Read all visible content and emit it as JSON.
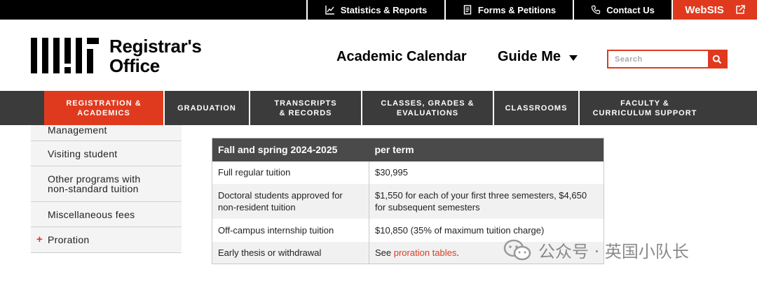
{
  "topbar": {
    "items": [
      {
        "label": "Statistics & Reports",
        "icon": "chart-line-icon"
      },
      {
        "label": "Forms & Petitions",
        "icon": "document-icon"
      },
      {
        "label": "Contact Us",
        "icon": "phone-icon"
      }
    ],
    "websis": {
      "label": "WebSIS",
      "icon": "external-link-icon"
    }
  },
  "header": {
    "site_title_line1": "Registrar's",
    "site_title_line2": "Office",
    "nav": {
      "calendar": "Academic Calendar",
      "guide": "Guide Me"
    },
    "search": {
      "placeholder": "Search"
    }
  },
  "mainnav": {
    "tabs": [
      {
        "label": "REGISTRATION & ACADEMICS",
        "active": true
      },
      {
        "label": "GRADUATION",
        "active": false
      },
      {
        "label": "TRANSCRIPTS & RECORDS",
        "active": false
      },
      {
        "label": "CLASSES, GRADES & EVALUATIONS",
        "active": false
      },
      {
        "label": "CLASSROOMS",
        "active": false
      },
      {
        "label": "FACULTY & CURRICULUM SUPPORT",
        "active": false
      }
    ]
  },
  "sidebar": {
    "items": [
      {
        "label": "Management"
      },
      {
        "label": "Visiting student"
      },
      {
        "label": "Other programs with non-standard tuition"
      },
      {
        "label": "Miscellaneous fees"
      },
      {
        "label": "Proration",
        "expandable": true,
        "marker": "+"
      }
    ]
  },
  "table": {
    "headers": [
      "Fall and spring 2024-2025",
      "per term"
    ],
    "rows": [
      {
        "item": "Full regular tuition",
        "amount": "$30,995"
      },
      {
        "item": "Doctoral students approved for non-resident tuition",
        "amount": "$1,550 for each of your first three semesters, $4,650 for subsequent semesters"
      },
      {
        "item": "Off-campus internship tuition",
        "amount": "$10,850 (35% of maximum tuition charge)"
      },
      {
        "item": "Early thesis or withdrawal",
        "amount_prefix": "See ",
        "amount_link": "proration tables",
        "amount_suffix": "."
      }
    ]
  },
  "watermark": {
    "text": "公众号 · 英国小队长"
  },
  "colors": {
    "accent": "#e03a1e",
    "nav_bg": "#3b3b3b",
    "topbar_bg": "#000000",
    "table_header_bg": "#4a4a4a"
  }
}
